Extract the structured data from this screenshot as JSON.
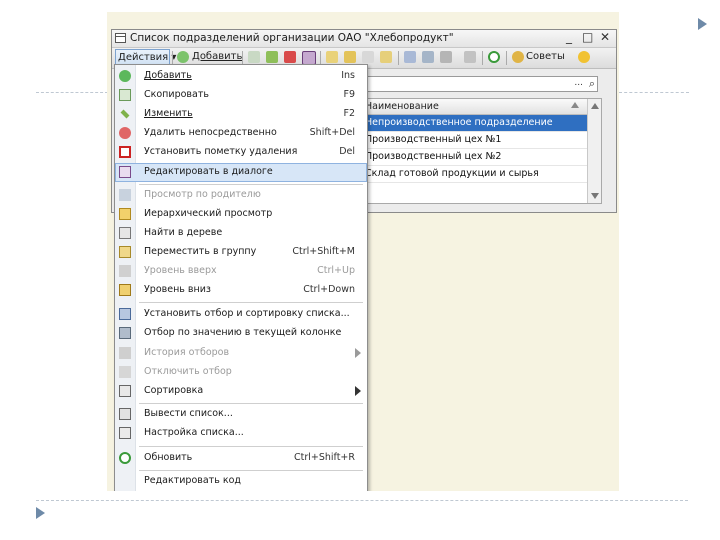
{
  "window": {
    "title": "Список подразделений организации ОАО \"Хлебопродукт\"",
    "btn_min": "_",
    "btn_max": "□",
    "btn_close": "✕"
  },
  "toolbar": {
    "actions_label": "Действия ▾",
    "add_label": "Добавить",
    "help_label": "Советы"
  },
  "search": {
    "value": "",
    "dots": "...",
    "glass": "⌕"
  },
  "grid": {
    "column_header": "Наименование",
    "rows": [
      "Непроизводственное подразделение",
      "Производственный цех №1",
      "Производственный цех №2",
      "Склад готовой продукции и сырья"
    ]
  },
  "menu": {
    "items": [
      {
        "label": "Добавить",
        "shortcut": "Ins"
      },
      {
        "label": "Скопировать",
        "shortcut": "F9"
      },
      {
        "label": "Изменить",
        "shortcut": "F2"
      },
      {
        "label": "Удалить непосредственно",
        "shortcut": "Shift+Del"
      },
      {
        "label": "Установить пометку удаления",
        "shortcut": "Del"
      },
      {
        "label": "Редактировать в диалоге",
        "shortcut": ""
      },
      {
        "label": "Просмотр по родителю",
        "shortcut": ""
      },
      {
        "label": "Иерархический просмотр",
        "shortcut": ""
      },
      {
        "label": "Найти в дереве",
        "shortcut": ""
      },
      {
        "label": "Переместить в группу",
        "shortcut": "Ctrl+Shift+M"
      },
      {
        "label": "Уровень вверх",
        "shortcut": "Ctrl+Up"
      },
      {
        "label": "Уровень вниз",
        "shortcut": "Ctrl+Down"
      },
      {
        "label": "Установить отбор и сортировку списка...",
        "shortcut": ""
      },
      {
        "label": "Отбор по значению в текущей колонке",
        "shortcut": ""
      },
      {
        "label": "История отборов",
        "shortcut": ""
      },
      {
        "label": "Отключить отбор",
        "shortcut": ""
      },
      {
        "label": "Сортировка",
        "shortcut": ""
      },
      {
        "label": "Вывести список...",
        "shortcut": ""
      },
      {
        "label": "Настройка списка...",
        "shortcut": ""
      },
      {
        "label": "Обновить",
        "shortcut": "Ctrl+Shift+R"
      },
      {
        "label": "Редактировать код",
        "shortcut": ""
      }
    ]
  },
  "colors": {
    "selection": "#2f6fc1",
    "menu_highlight": "#d7e6f7",
    "slide_accent": "#6e8aa8"
  }
}
